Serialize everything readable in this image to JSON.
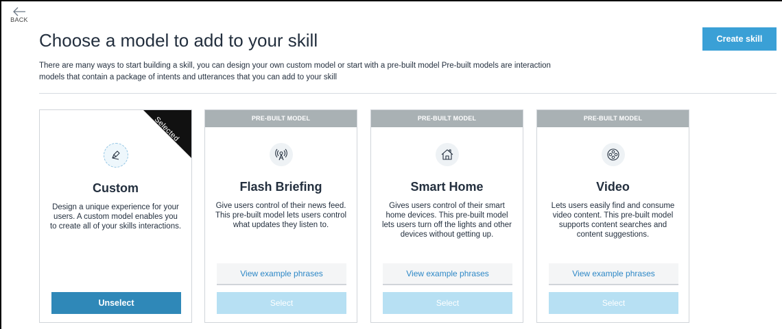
{
  "nav": {
    "back_label": "BACK"
  },
  "header": {
    "title": "Choose a model to add to your skill",
    "description": "There are many ways to start building a skill, you can design your own custom model or start with a pre-built model  Pre-built models are interaction models that contain a package of intents and utterances that you can add to your skill",
    "create_button": "Create skill"
  },
  "colors": {
    "accent": "#3aa0d6",
    "selected_button": "#2f88b8",
    "disabled_select": "#b7e0f3",
    "banner": "#a9b1b4",
    "link": "#2c87c6"
  },
  "cards": [
    {
      "icon": "pencil-icon",
      "title": "Custom",
      "description": "Design a unique experience for your users. A custom model enables you to create all of your skills interactions.",
      "selected": true,
      "ribbon": "Selected",
      "action_label": "Unselect"
    },
    {
      "banner": "PRE-BUILT MODEL",
      "icon": "broadcast-icon",
      "title": "Flash Briefing",
      "description": "Give users control of their news feed. This pre-built model lets users control what updates they listen to.",
      "phrases_label": "View example phrases",
      "action_label": "Select"
    },
    {
      "banner": "PRE-BUILT MODEL",
      "icon": "home-icon",
      "title": "Smart Home",
      "description": "Gives users control of their smart home devices. This pre-built model lets users turn off the lights and other devices without getting up.",
      "phrases_label": "View example phrases",
      "action_label": "Select"
    },
    {
      "banner": "PRE-BUILT MODEL",
      "icon": "film-reel-icon",
      "title": "Video",
      "description": "Lets users easily find and consume video content. This pre-built model supports content searches and content suggestions.",
      "phrases_label": "View example phrases",
      "action_label": "Select"
    }
  ]
}
